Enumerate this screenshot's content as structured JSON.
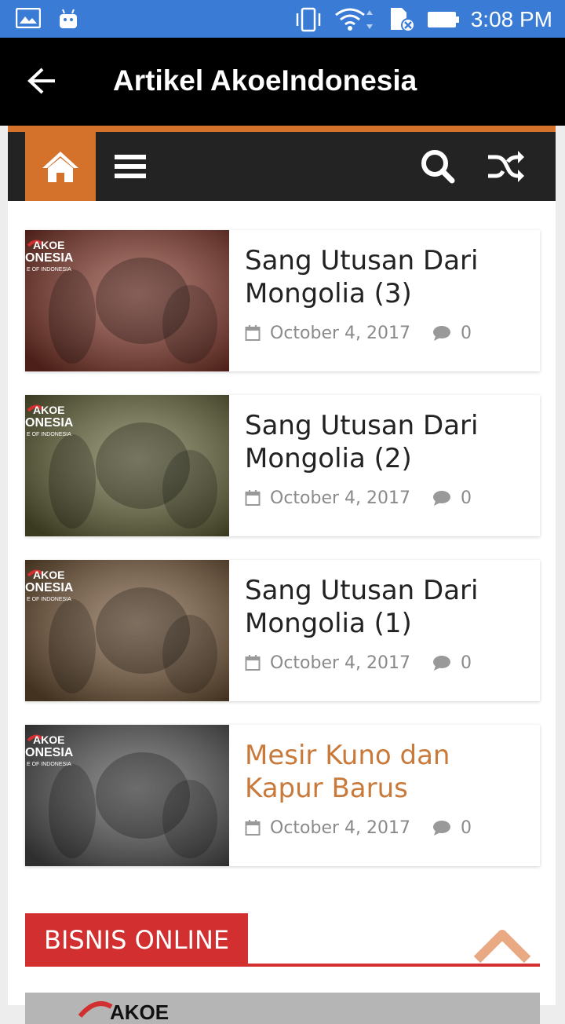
{
  "status_bar": {
    "time": "3:08 PM"
  },
  "app_bar": {
    "title": "Artikel AkoeIndonesia"
  },
  "articles": [
    {
      "title_line1": "Sang Utusan Dari",
      "title_line2": "Mongolia (3)",
      "date": "October 4, 2017",
      "comments": "0",
      "highlighted": false,
      "tint": "#8a3a2c"
    },
    {
      "title_line1": "Sang Utusan Dari",
      "title_line2": "Mongolia (2)",
      "date": "October 4, 2017",
      "comments": "0",
      "highlighted": false,
      "tint": "#6a6a3c"
    },
    {
      "title_line1": "Sang Utusan Dari",
      "title_line2": "Mongolia (1)",
      "date": "October 4, 2017",
      "comments": "0",
      "highlighted": false,
      "tint": "#7a5a3a"
    },
    {
      "title_line1": "Mesir Kuno dan",
      "title_line2": "Kapur Barus",
      "date": "October 4, 2017",
      "comments": "0",
      "highlighted": true,
      "tint": "#555555"
    }
  ],
  "thumb_logo": {
    "line1": "AKOE",
    "line2": "ONESIA",
    "tagline": "E OF INDONESIA"
  },
  "section": {
    "label": "BISNIS ONLINE"
  },
  "colors": {
    "accent_orange": "#d4722c",
    "section_red": "#d23030",
    "nav_dark": "#232323",
    "highlight_title": "#c97a3a"
  }
}
